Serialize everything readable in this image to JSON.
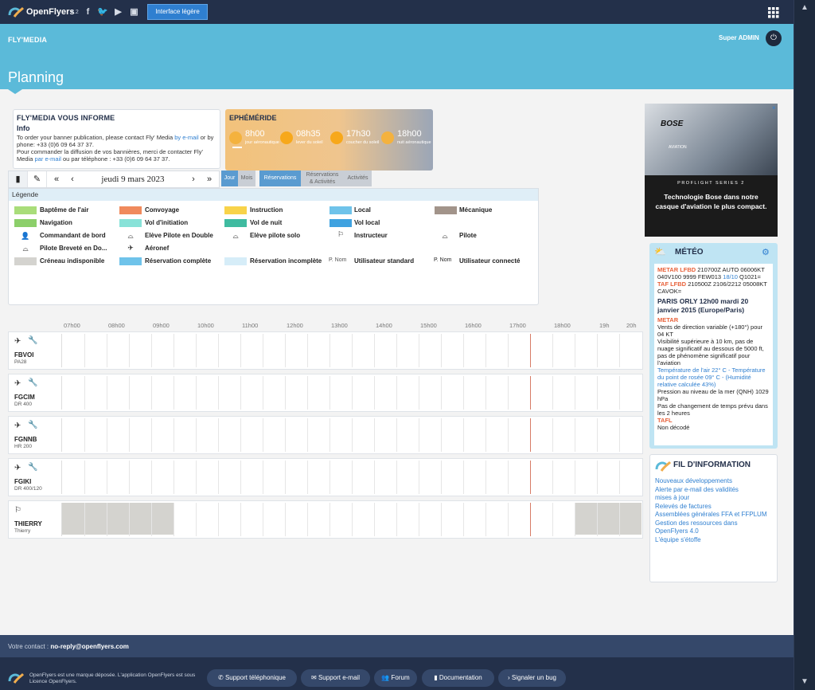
{
  "topbar": {
    "brand": "OpenFlyers",
    "version": "4.2",
    "light_btn": "Interface légère",
    "social_icons": [
      "facebook-icon",
      "twitter-icon",
      "youtube-icon",
      "image-icon"
    ]
  },
  "header": {
    "org": "FLY'MEDIA",
    "user": "Super ADMIN",
    "title": "Planning"
  },
  "info": {
    "title": "FLY'MEDIA VOUS INFORME",
    "subtitle": "Info",
    "line1a": "To order your banner publication, please contact Fly' Media ",
    "line1b": "by e-mail",
    "line1c": " or by phone: +33 (0)6 09 64 37 37.",
    "line2a": "Pour commander la diffusion de vos bannières, merci de contacter Fly' Media ",
    "line2b": "par e-mail",
    "line2c": " ou par téléphone : +33 (0)6 09 64 37 37."
  },
  "ephemeride": {
    "title": "EPHÉMÉRIDE",
    "items": [
      {
        "time": "8h00",
        "label": "jour aéronautique",
        "color": "#f4b23e"
      },
      {
        "time": "08h35",
        "label": "lever du soleil",
        "color": "#f7a81b"
      },
      {
        "time": "17h30",
        "label": "coucher du soleil",
        "color": "#f7a81b"
      },
      {
        "time": "18h00",
        "label": "nuit aéronautique",
        "color": "#f4b23e"
      }
    ]
  },
  "nav": {
    "date": "jeudi 9 mars 2023",
    "tabs": {
      "jour": "Jour",
      "mois": "Mois",
      "reservations": "Réservations",
      "res_act_1": "Réservations",
      "res_act_2": "& Activités",
      "activites": "Activités"
    }
  },
  "legend": {
    "title": "Légende",
    "items": [
      {
        "label": "Baptême de l'air",
        "color": "#a9dd7a"
      },
      {
        "label": "Convoyage",
        "color": "#f08a5d"
      },
      {
        "label": "Instruction",
        "color": "#f8d34a"
      },
      {
        "label": "Local",
        "color": "#6fc3ea"
      },
      {
        "label": "Mécanique",
        "color": "#a2948a"
      },
      {
        "label": "Navigation",
        "color": "#8ccf6a"
      },
      {
        "label": "Vol d'initiation",
        "color": "#88e2d8"
      },
      {
        "label": "Vol de nuit",
        "color": "#3fbba0"
      },
      {
        "label": "Vol local",
        "color": "#3fa2e0"
      },
      {
        "label": "Commandant de bord",
        "icon": "pilot-icon"
      },
      {
        "label": "Elève Pilote en Double",
        "icon": "student-double-icon"
      },
      {
        "label": "Elève pilote solo",
        "icon": "student-solo-icon"
      },
      {
        "label": "Instructeur",
        "icon": "instructor-icon"
      },
      {
        "label": "Pilote",
        "icon": "pilot-wings-icon"
      },
      {
        "label": "Pilote Breveté en Do...",
        "icon": "licensed-pilot-icon"
      },
      {
        "label": "Aéronef",
        "icon": "aircraft-icon"
      },
      {
        "label": "Créneau indisponible",
        "color": "#d4d3cf"
      },
      {
        "label": "Réservation complète",
        "color": "#6fc3ea"
      },
      {
        "label": "Réservation incomplète",
        "color": "#d6edf8"
      },
      {
        "label": "Utilisateur standard",
        "prefix": "P. Nom"
      },
      {
        "label": "Utilisateur connecté",
        "prefix": "P. Nom"
      }
    ]
  },
  "hours": [
    "07h00",
    "08h00",
    "09h00",
    "10h00",
    "11h00",
    "12h00",
    "13h00",
    "14h00",
    "15h00",
    "16h00",
    "17h00",
    "18h00",
    "19h",
    "20h"
  ],
  "resources": [
    {
      "name": "FBVOI",
      "sub": "PA28",
      "wrench": "#5cb85c"
    },
    {
      "name": "FGCIM",
      "sub": "DR 400",
      "wrench": "#f0ad4e"
    },
    {
      "name": "FGNNB",
      "sub": "HR 200",
      "wrench": "#5cb85c"
    },
    {
      "name": "FGIKI",
      "sub": "DR 400/120",
      "wrench": "#5cb85c"
    },
    {
      "name": "THIERRY",
      "sub": "Thierry",
      "wrench": ""
    }
  ],
  "ad": {
    "brand": "BOSE",
    "tag": "AVIATION",
    "series": "PROFLIGHT SERIES 2",
    "text": "Technologie Bose dans notre casque d'aviation le plus compact."
  },
  "meteo": {
    "title": "MÉTÉO",
    "metar_label": "METAR LFBD",
    "metar_text": " 210700Z AUTO 06006KT 040V100 9999 FEW013",
    "metar_link": "18/10",
    "metar_tail": " Q1021=",
    "taf_label": "TAF LFBD",
    "taf_text": " 210500Z 2106/2212 05008KT CAVOK=",
    "station": "PARIS ORLY 12h00 mardi 20 janvier 2015 (Europe/Paris)",
    "metar2": "METAR",
    "wind": "Vents de direction variable (+180°) pour 04 KT",
    "vis": "Visibilité supérieure à 10 km, pas de nuage significatif au dessous de 5000 ft, pas de phénomène significatif pour l'aviation",
    "temp": "Température de l'air 22° C - Température du point de rosée 09° C - (Humidité relative calculée 43%)",
    "press": "Pression au niveau de la mer (QNH) 1029 hPa",
    "trend": "Pas de changement de temps prévu dans les 2 heures",
    "tafl": "TAFL",
    "decode": "Non décodé"
  },
  "fil": {
    "title": "FIL D'INFORMATION",
    "items": [
      "Nouveaux développements",
      "Alerte par e-mail des validités",
      "mises à jour",
      "Relevés de factures",
      "Assemblées générales FFA et FFPLUM",
      "Gestion des ressources dans",
      "OpenFlyers 4.0",
      "L'équipe s'étoffe"
    ]
  },
  "contact": {
    "label": "Votre contact : ",
    "email": "no-reply@openflyers.com"
  },
  "footer": {
    "text": "OpenFlyers est une marque déposée. L'application OpenFlyers est sous Licence OpenFlyers.",
    "buttons": [
      "Support téléphonique",
      "Support e-mail",
      "Forum",
      "Documentation",
      "Signaler un bug"
    ]
  }
}
